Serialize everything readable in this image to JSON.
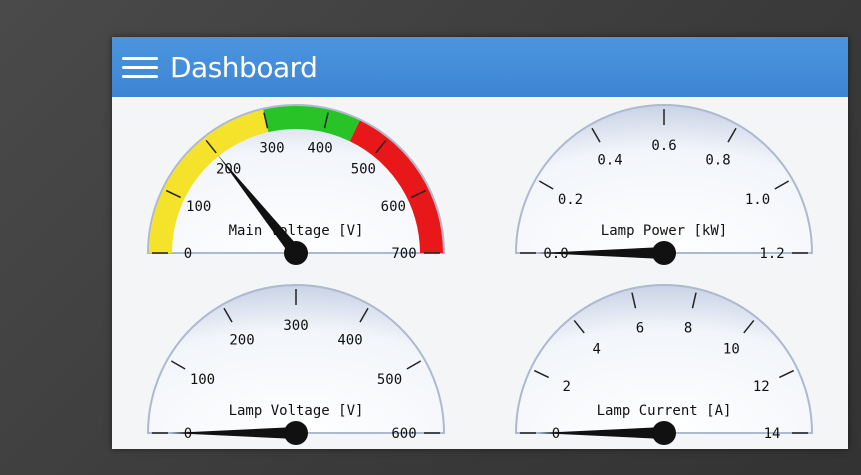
{
  "header": {
    "title": "Dashboard",
    "menu_icon": "hamburger-menu-icon"
  },
  "colors": {
    "header": "#4390dc",
    "zone_yellow": "#f5e22a",
    "zone_green": "#27c327",
    "zone_red": "#e8171a",
    "needle": "#111111"
  },
  "gauges": {
    "main_voltage": {
      "label": "Main Voltage [V]",
      "min": 0,
      "max": 700,
      "value": 200,
      "ticks": [
        "0",
        "100",
        "200",
        "300",
        "400",
        "500",
        "600",
        "700"
      ],
      "zones": [
        {
          "from": 0,
          "to": 300,
          "color": "#f5e22a"
        },
        {
          "from": 300,
          "to": 450,
          "color": "#27c327"
        },
        {
          "from": 450,
          "to": 700,
          "color": "#e8171a"
        }
      ]
    },
    "lamp_power": {
      "label": "Lamp Power [kW]",
      "min": 0,
      "max": 1.2,
      "value": 0,
      "ticks": [
        "0.0",
        "0.2",
        "0.4",
        "0.6",
        "0.8",
        "1.0",
        "1.2"
      ]
    },
    "lamp_voltage": {
      "label": "Lamp Voltage [V]",
      "min": 0,
      "max": 600,
      "value": 0,
      "ticks": [
        "0",
        "100",
        "200",
        "300",
        "400",
        "500",
        "600"
      ]
    },
    "lamp_current": {
      "label": "Lamp Current [A]",
      "min": 0,
      "max": 14,
      "value": 0,
      "ticks": [
        "0",
        "2",
        "4",
        "6",
        "8",
        "10",
        "12",
        "14"
      ]
    }
  }
}
